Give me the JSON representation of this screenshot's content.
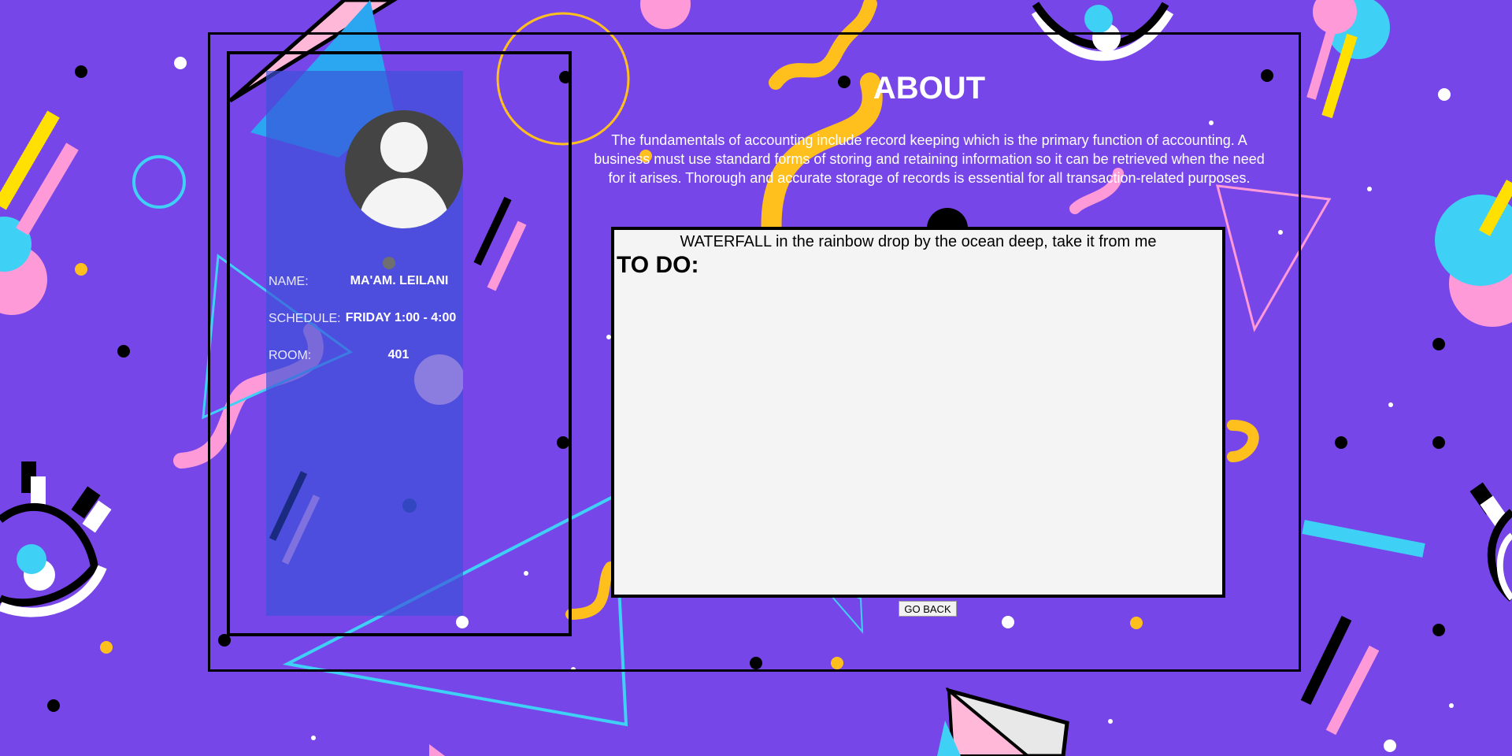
{
  "theme": {
    "background": "#7746e8",
    "card": "#3b52d8",
    "accent_yellow": "#ffc01e",
    "accent_cyan": "#3fd0f5",
    "accent_pink": "#ff9ad8"
  },
  "profile": {
    "avatar_icon": "user-avatar-icon",
    "name_label": "NAME:",
    "name_value": "MA'AM. LEILANI",
    "schedule_label": "SCHEDULE:",
    "schedule_value": "FRIDAY 1:00 - 4:00",
    "room_label": "ROOM:",
    "room_value": "401"
  },
  "about": {
    "title": "ABOUT",
    "description": "The fundamentals of accounting include record keeping which is the primary function of accounting. A business must use standard forms of storing and retaining information so it can be retrieved when the need for it arises. Thorough and accurate storage of records is essential for all transaction-related purposes."
  },
  "todo": {
    "subtitle": "WATERFALL in the rainbow drop by the ocean deep, take it from me",
    "heading": "TO DO:"
  },
  "actions": {
    "go_back_label": "GO BACK"
  }
}
